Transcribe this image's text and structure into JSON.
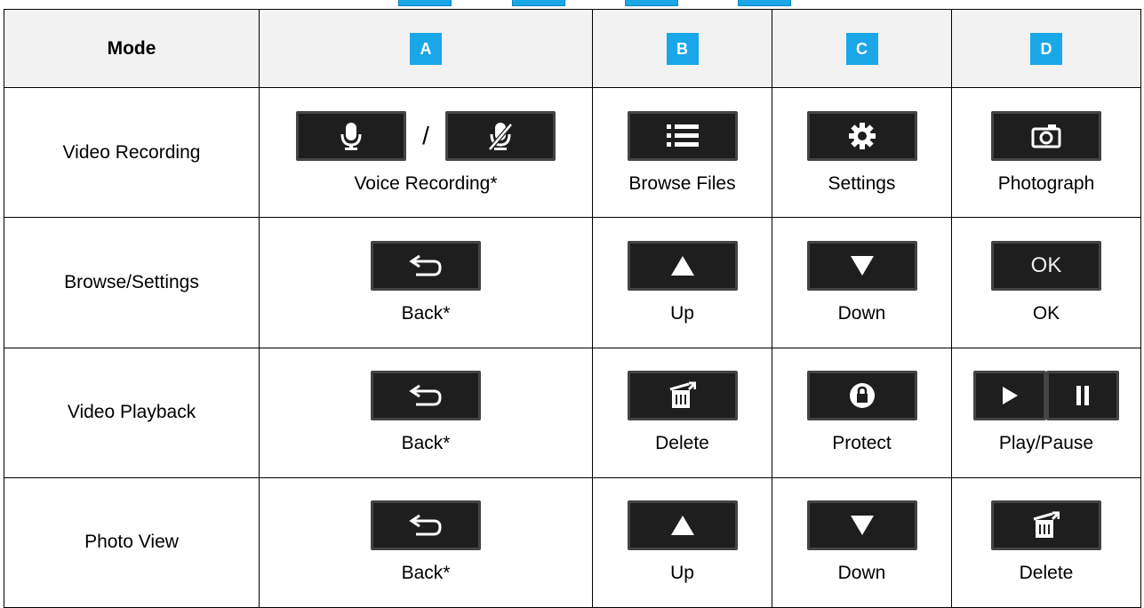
{
  "header": {
    "mode_label": "Mode",
    "columns": [
      "A",
      "B",
      "C",
      "D"
    ]
  },
  "rows": [
    {
      "mode": "Video Recording",
      "a": {
        "icons": [
          "microphone-icon",
          "microphone-muted-icon"
        ],
        "separator": "/",
        "label": "Voice Recording*"
      },
      "b": {
        "icon": "list-icon",
        "label": "Browse Files"
      },
      "c": {
        "icon": "gear-icon",
        "label": "Settings"
      },
      "d": {
        "icon": "camera-icon",
        "label": "Photograph"
      }
    },
    {
      "mode": "Browse/Settings",
      "a": {
        "icon": "back-arrow-icon",
        "label": "Back*"
      },
      "b": {
        "icon": "up-triangle-icon",
        "label": "Up"
      },
      "c": {
        "icon": "down-triangle-icon",
        "label": "Down"
      },
      "d": {
        "button_text": "OK",
        "label": "OK"
      }
    },
    {
      "mode": "Video Playback",
      "a": {
        "icon": "back-arrow-icon",
        "label": "Back*"
      },
      "b": {
        "icon": "trash-icon",
        "label": "Delete"
      },
      "c": {
        "icon": "lock-icon",
        "label": "Protect"
      },
      "d": {
        "icons": [
          "play-icon",
          "pause-icon"
        ],
        "label": "Play/Pause"
      }
    },
    {
      "mode": "Photo View",
      "a": {
        "icon": "back-arrow-icon",
        "label": "Back*"
      },
      "b": {
        "icon": "up-triangle-icon",
        "label": "Up"
      },
      "c": {
        "icon": "down-triangle-icon",
        "label": "Down"
      },
      "d": {
        "icon": "trash-icon",
        "label": "Delete"
      }
    }
  ],
  "colors": {
    "badge": "#1aa7e8",
    "button": "#1e1e1e",
    "icon": "#ffffff"
  }
}
